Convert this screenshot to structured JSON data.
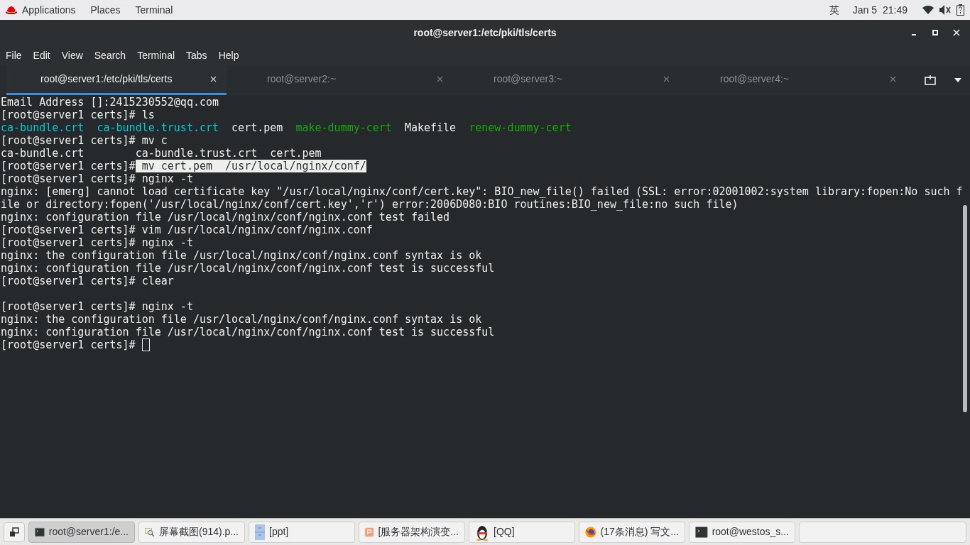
{
  "top_bar": {
    "menus": [
      "Applications",
      "Places",
      "Terminal"
    ],
    "input_method": "英",
    "date": "Jan 5",
    "time": "21:49"
  },
  "window": {
    "title": "root@server1:/etc/pki/tls/certs"
  },
  "menu_bar": [
    "File",
    "Edit",
    "View",
    "Search",
    "Terminal",
    "Tabs",
    "Help"
  ],
  "tabs": [
    {
      "label": "root@server1:/etc/pki/tls/certs",
      "selected": true
    },
    {
      "label": "root@server2:~",
      "selected": false
    },
    {
      "label": "root@server3:~",
      "selected": false
    },
    {
      "label": "root@server4:~",
      "selected": false
    }
  ],
  "terminal": {
    "lines": [
      {
        "kind": "text",
        "segments": [
          {
            "kind": "plain",
            "text": "Email Address []:2415230552@qq.com"
          }
        ]
      },
      {
        "kind": "text",
        "segments": [
          {
            "kind": "plain",
            "text": "[root@server1 certs]# ls"
          }
        ]
      },
      {
        "kind": "columns",
        "segments": [
          {
            "kind": "dir",
            "text": "ca-bundle.crt"
          },
          {
            "kind": "dir",
            "text": "ca-bundle.trust.crt"
          },
          {
            "kind": "plain",
            "text": "cert.pem"
          },
          {
            "kind": "exec",
            "text": "make-dummy-cert"
          },
          {
            "kind": "plain",
            "text": "Makefile"
          },
          {
            "kind": "exec",
            "text": "renew-dummy-cert"
          }
        ]
      },
      {
        "kind": "text",
        "segments": [
          {
            "kind": "plain",
            "text": "[root@server1 certs]# mv c"
          }
        ]
      },
      {
        "kind": "text",
        "segments": [
          {
            "kind": "plain",
            "text": "ca-bundle.crt        ca-bundle.trust.crt  cert.pem"
          }
        ]
      },
      {
        "kind": "text",
        "segments": [
          {
            "kind": "plain",
            "text": "[root@server1 certs]#"
          },
          {
            "kind": "selected",
            "text": " mv cert.pem  /usr/local/nginx/conf/"
          }
        ]
      },
      {
        "kind": "text",
        "segments": [
          {
            "kind": "plain",
            "text": "[root@server1 certs]# nginx -t"
          }
        ]
      },
      {
        "kind": "text",
        "segments": [
          {
            "kind": "plain",
            "text": "nginx: [emerg] cannot load certificate key \"/usr/local/nginx/conf/cert.key\": BIO_new_file() failed (SSL: error:02001002:system library:fopen:No such f"
          }
        ]
      },
      {
        "kind": "text",
        "segments": [
          {
            "kind": "plain",
            "text": "ile or directory:fopen('/usr/local/nginx/conf/cert.key','r') error:2006D080:BIO routines:BIO_new_file:no such file)"
          }
        ]
      },
      {
        "kind": "text",
        "segments": [
          {
            "kind": "plain",
            "text": "nginx: configuration file /usr/local/nginx/conf/nginx.conf test failed"
          }
        ]
      },
      {
        "kind": "text",
        "segments": [
          {
            "kind": "plain",
            "text": "[root@server1 certs]# vim /usr/local/nginx/conf/nginx.conf"
          }
        ]
      },
      {
        "kind": "text",
        "segments": [
          {
            "kind": "plain",
            "text": "[root@server1 certs]# nginx -t"
          }
        ]
      },
      {
        "kind": "text",
        "segments": [
          {
            "kind": "plain",
            "text": "nginx: the configuration file /usr/local/nginx/conf/nginx.conf syntax is ok"
          }
        ]
      },
      {
        "kind": "text",
        "segments": [
          {
            "kind": "plain",
            "text": "nginx: configuration file /usr/local/nginx/conf/nginx.conf test is successful"
          }
        ]
      },
      {
        "kind": "text",
        "segments": [
          {
            "kind": "plain",
            "text": "[root@server1 certs]# clear"
          }
        ]
      },
      {
        "kind": "blank"
      },
      {
        "kind": "text",
        "segments": [
          {
            "kind": "plain",
            "text": "[root@server1 certs]# nginx -t"
          }
        ]
      },
      {
        "kind": "text",
        "segments": [
          {
            "kind": "plain",
            "text": "nginx: the configuration file /usr/local/nginx/conf/nginx.conf syntax is ok"
          }
        ]
      },
      {
        "kind": "text",
        "segments": [
          {
            "kind": "plain",
            "text": "nginx: configuration file /usr/local/nginx/conf/nginx.conf test is successful"
          }
        ]
      },
      {
        "kind": "text",
        "cursor": true,
        "segments": [
          {
            "kind": "plain",
            "text": "[root@server1 certs]#"
          }
        ]
      }
    ]
  },
  "taskbar": [
    {
      "kind": "terminal",
      "label": "root@server1:/e...",
      "selected": true
    },
    {
      "kind": "screenshot",
      "label": "屏幕截图(914).p...",
      "selected": false
    },
    {
      "kind": "cabinet",
      "label": "[ppt]",
      "selected": false
    },
    {
      "kind": "slides",
      "label": "[服务器架构演变...",
      "selected": false
    },
    {
      "kind": "penguin",
      "label": "[QQ]",
      "selected": false
    },
    {
      "kind": "browser",
      "label": "(17条消息) 写文...",
      "selected": false
    },
    {
      "kind": "terminal",
      "label": "root@westos_s...",
      "selected": false
    }
  ]
}
